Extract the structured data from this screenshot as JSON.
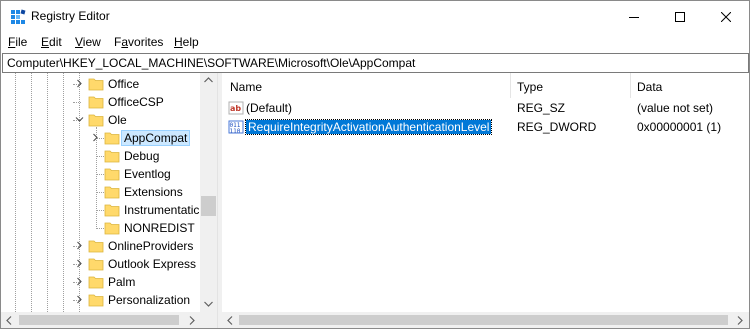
{
  "window": {
    "title": "Registry Editor"
  },
  "menu": [
    {
      "label": "File",
      "accel": "F",
      "rest": "ile"
    },
    {
      "label": "Edit",
      "accel": "E",
      "rest": "dit"
    },
    {
      "label": "View",
      "accel": "V",
      "rest": "iew"
    },
    {
      "label": "Favorites",
      "accel": "a",
      "pre": "F",
      "rest": "vorites"
    },
    {
      "label": "Help",
      "accel": "H",
      "rest": "elp"
    }
  ],
  "address": {
    "path": "Computer\\HKEY_LOCAL_MACHINE\\SOFTWARE\\Microsoft\\Ole\\AppCompat"
  },
  "tree": {
    "items": [
      {
        "label": "Office",
        "expandable": true
      },
      {
        "label": "OfficeCSP",
        "expandable": false
      },
      {
        "label": "Ole",
        "expandable": true,
        "expanded": true
      },
      {
        "label": "AppCompat",
        "expandable": true,
        "selected": true
      },
      {
        "label": "Debug",
        "expandable": false
      },
      {
        "label": "Eventlog",
        "expandable": false
      },
      {
        "label": "Extensions",
        "expandable": false
      },
      {
        "label": "Instrumentatic",
        "expandable": false
      },
      {
        "label": "NONREDIST",
        "expandable": false
      },
      {
        "label": "OnlineProviders",
        "expandable": true
      },
      {
        "label": "Outlook Express",
        "expandable": true
      },
      {
        "label": "Palm",
        "expandable": true
      },
      {
        "label": "Personalization",
        "expandable": true
      }
    ]
  },
  "list": {
    "columns": {
      "name": "Name",
      "type": "Type",
      "data": "Data"
    },
    "rows": [
      {
        "icon": "string-value-icon",
        "name": "(Default)",
        "type": "REG_SZ",
        "data": "(value not set)"
      },
      {
        "icon": "dword-value-icon",
        "name": "RequireIntegrityActivationAuthenticationLevel",
        "type": "REG_DWORD",
        "data": "0x00000001 (1)",
        "selected": true
      }
    ]
  },
  "colors": {
    "selection": "#0078d7",
    "tree_selection": "#cce8ff",
    "folder": "#ffd96b",
    "folder_edge": "#dcb53d"
  }
}
